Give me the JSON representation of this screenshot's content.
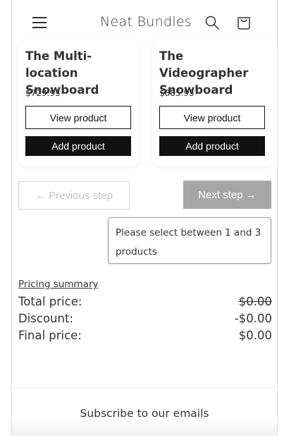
{
  "header": {
    "brand": "Neat Bundles",
    "icons": [
      "hamburger-menu-icon",
      "search-icon",
      "cart-icon"
    ]
  },
  "products": [
    {
      "title": "The Multi-location Snowboard",
      "price": "$729.95",
      "view_label": "View product",
      "add_label": "Add product"
    },
    {
      "title": "The Videographer Snowboard",
      "price": "$885.95",
      "view_label": "View product",
      "add_label": "Add product"
    }
  ],
  "steps": {
    "previous_label": "← Previous step",
    "next_label": "Next step →",
    "tooltip": "Please select between 1 and 3 products"
  },
  "pricing": {
    "title": "Pricing summary",
    "rows": [
      {
        "label": "Total price:",
        "value": "$0.00"
      },
      {
        "label": "Discount:",
        "value": "-$0.00"
      },
      {
        "label": "Final price:",
        "value": "$0.00"
      }
    ]
  },
  "footer": {
    "subscribe_text": "Subscribe to our emails"
  },
  "colors": {
    "primary_button": "#111111",
    "disabled_button": "#a6a6a6",
    "disabled_text": "#c4c4c4"
  }
}
